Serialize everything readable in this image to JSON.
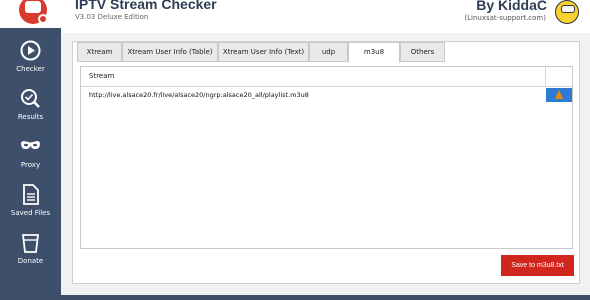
{
  "header": {
    "title": "IPTV Stream Checker",
    "version": "V3.03 Deluxe Edition",
    "author": "By KiddaC",
    "site": "(Linuxsat-support.com)"
  },
  "sidebar": {
    "items": [
      {
        "label": "Checker",
        "icon": "play-circle-icon"
      },
      {
        "label": "Results",
        "icon": "search-check-icon"
      },
      {
        "label": "Proxy",
        "icon": "mask-icon"
      },
      {
        "label": "Saved Files",
        "icon": "document-icon"
      },
      {
        "label": "Donate",
        "icon": "cup-icon"
      }
    ]
  },
  "tabs": [
    {
      "label": "Xtream"
    },
    {
      "label": "Xtream User Info (Table)"
    },
    {
      "label": "Xtream User Info (Text)"
    },
    {
      "label": "udp"
    },
    {
      "label": "m3u8",
      "active": true
    },
    {
      "label": "Others"
    }
  ],
  "grid": {
    "column_header": "Stream",
    "rows": [
      {
        "url": "http://live.alsace20.fr/live/alsace20/ngrp:alsace20_all/playlist.m3u8"
      }
    ]
  },
  "actions": {
    "save_label": "Save to m3u8.txt"
  },
  "colors": {
    "sidebar": "#3d4f6b",
    "accent": "#d0261e",
    "vlc_button": "#2f7bd4"
  }
}
